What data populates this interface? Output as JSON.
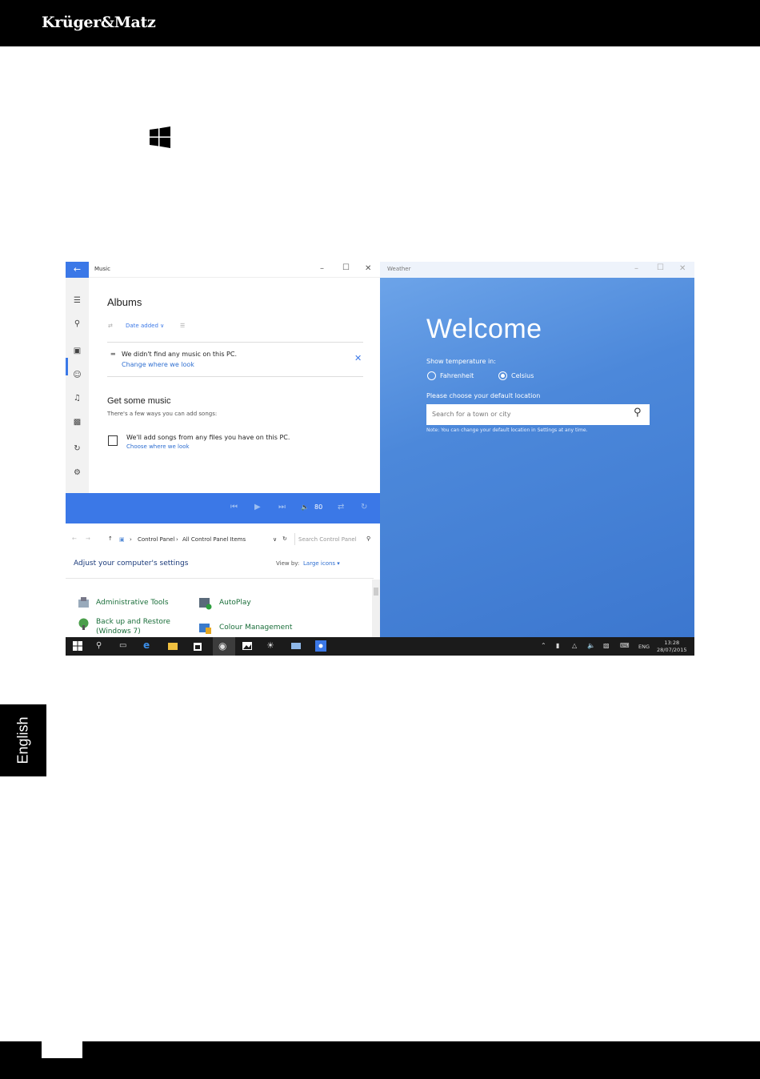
{
  "brand": {
    "logo_text": "Krüger&Matz"
  },
  "language_tab": "English",
  "music_app": {
    "title": "Music",
    "heading": "Albums",
    "sort_label": "Date added ∨",
    "notice": "We didn't find any music on this PC.",
    "notice_link": "Change where we look",
    "section_title": "Get some music",
    "section_subtitle": "There's a few ways you can add songs:",
    "add_songs_text": "We'll add songs from any files you have on this PC.",
    "add_songs_link": "Choose where we look",
    "volume_label": "80"
  },
  "control_panel": {
    "breadcrumb_1": "Control Panel",
    "breadcrumb_2": "All Control Panel Items",
    "search_placeholder": "Search Control Panel",
    "heading": "Adjust your computer's settings",
    "view_by_label": "View by:",
    "view_by_value": "Large icons ▾",
    "items": [
      "Administrative Tools",
      "AutoPlay",
      "Back up and Restore",
      "(Windows 7)",
      "Colour Management"
    ]
  },
  "weather_app": {
    "title": "Weather",
    "welcome": "Welcome",
    "temp_prompt": "Show temperature in:",
    "option_fahrenheit": "Fahrenheit",
    "option_celsius": "Celsius",
    "location_prompt": "Please choose your default location",
    "search_placeholder": "Search for a town or city",
    "note": "Note: You can change your default location in Settings at any time."
  },
  "taskbar": {
    "language": "ENG",
    "time": "13:28",
    "date": "28/07/2015"
  }
}
